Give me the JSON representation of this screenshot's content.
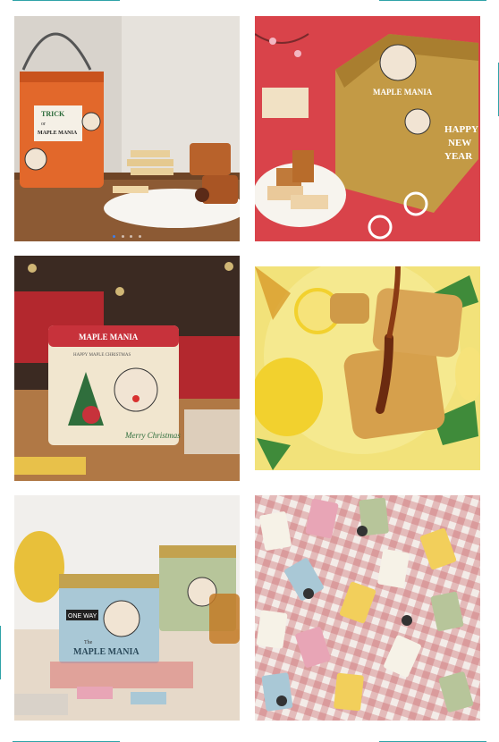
{
  "images": [
    {
      "alt": "Halloween tin with cookies and financiers",
      "texts": {
        "trick": "TRICK",
        "or": "or",
        "maple": "MAPLE MANIA"
      },
      "carousel_dots": 4,
      "active_dot": 0
    },
    {
      "alt": "New Year gift box with cookies",
      "texts": {
        "maple": "MAPLE MANIA",
        "happy": "HAPPY",
        "new": "NEW",
        "year": "YEAR"
      }
    },
    {
      "alt": "Christmas tin with tree and ornaments",
      "texts": {
        "maple": "MAPLE MANIA",
        "happy_xmas": "HAPPY MAPLE CHRISTMAS",
        "merry": "Merry Christmas"
      }
    },
    {
      "alt": "Waffles with syrup and lemons"
    },
    {
      "alt": "Blue and green Maple Mania tins",
      "texts": {
        "one_way": "ONE WAY",
        "maple": "MAPLE MANIA",
        "the": "The"
      }
    },
    {
      "alt": "Individually wrapped cookies on checkered cloth"
    }
  ],
  "colors": {
    "frame": "#2fa3a8",
    "orange_tin": "#e2682b",
    "red_bg": "#d9434a",
    "gold_box": "#c39a45",
    "cream_tin": "#f1e6cf",
    "yellow_bg": "#f2e27a",
    "blue_tin": "#a9c8d6",
    "green_tin": "#b7c59a",
    "check_red": "#c85d64"
  }
}
